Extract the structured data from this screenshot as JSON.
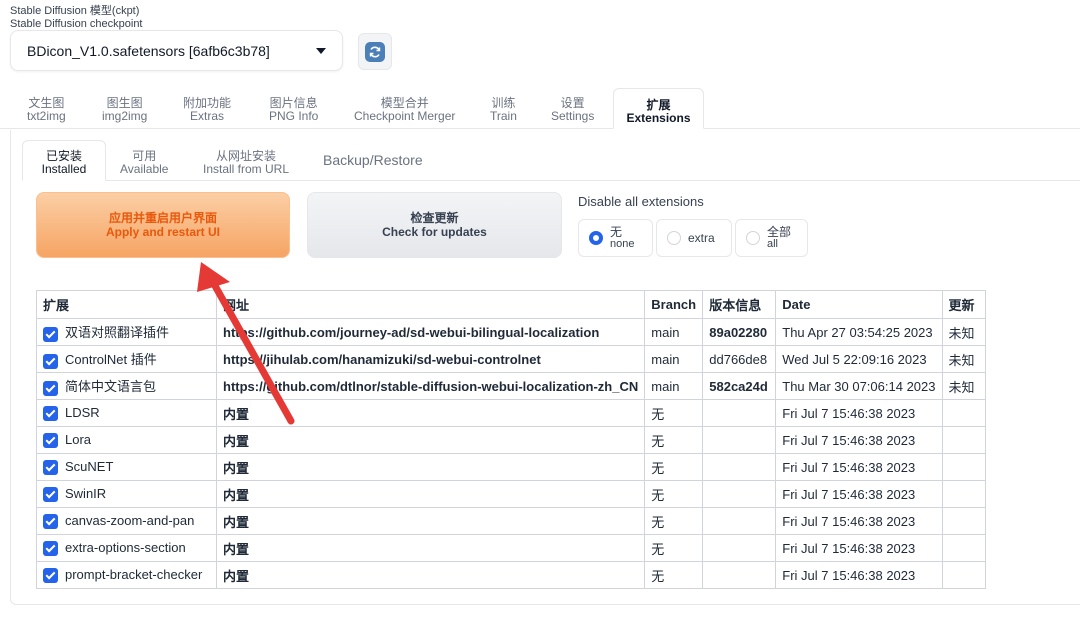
{
  "checkpoint": {
    "label_line1": "Stable Diffusion 模型(ckpt)",
    "label_line2": "Stable Diffusion checkpoint",
    "value": "BDicon_V1.0.safetensors [6afb6c3b78]"
  },
  "main_tabs": [
    {
      "cn": "文生图",
      "en": "txt2img"
    },
    {
      "cn": "图生图",
      "en": "img2img"
    },
    {
      "cn": "附加功能",
      "en": "Extras"
    },
    {
      "cn": "图片信息",
      "en": "PNG Info"
    },
    {
      "cn": "模型合并",
      "en": "Checkpoint Merger"
    },
    {
      "cn": "训练",
      "en": "Train"
    },
    {
      "cn": "设置",
      "en": "Settings"
    },
    {
      "cn": "扩展",
      "en": "Extensions"
    }
  ],
  "sub_tabs": [
    {
      "cn": "已安装",
      "en": "Installed"
    },
    {
      "cn": "可用",
      "en": "Available"
    },
    {
      "cn": "从网址安装",
      "en": "Install from URL"
    },
    {
      "label": "Backup/Restore"
    }
  ],
  "apply_button": {
    "cn": "应用并重启用户界面",
    "en": "Apply and restart UI"
  },
  "check_button": {
    "cn": "检查更新",
    "en": "Check for updates"
  },
  "disable": {
    "label": "Disable all extensions",
    "options": [
      {
        "cn": "无",
        "en": "none",
        "selected": true
      },
      {
        "label": "extra",
        "selected": false
      },
      {
        "cn": "全部",
        "en": "all",
        "selected": false
      }
    ]
  },
  "table": {
    "headers": [
      "扩展",
      "网址",
      "Branch",
      "版本信息",
      "Date",
      "更新"
    ],
    "rows": [
      {
        "name": "双语对照翻译插件",
        "url": "https://github.com/journey-ad/sd-webui-bilingual-localization",
        "branch": "main",
        "version": "89a02280",
        "date": "Thu Apr 27 03:54:25 2023",
        "update": "未知"
      },
      {
        "name": "ControlNet 插件",
        "url": "https://jihulab.com/hanamizuki/sd-webui-controlnet",
        "branch": "main",
        "version": "dd766de8",
        "date": "Wed Jul 5 22:09:16 2023",
        "update": "未知"
      },
      {
        "name": "简体中文语言包",
        "url": "https://github.com/dtlnor/stable-diffusion-webui-localization-zh_CN",
        "branch": "main",
        "version": "582ca24d",
        "date": "Thu Mar 30 07:06:14 2023",
        "update": "未知"
      },
      {
        "name": "LDSR",
        "url": "内置",
        "branch": "无",
        "version": "",
        "date": "Fri Jul 7 15:46:38 2023",
        "update": ""
      },
      {
        "name": "Lora",
        "url": "内置",
        "branch": "无",
        "version": "",
        "date": "Fri Jul 7 15:46:38 2023",
        "update": ""
      },
      {
        "name": "ScuNET",
        "url": "内置",
        "branch": "无",
        "version": "",
        "date": "Fri Jul 7 15:46:38 2023",
        "update": ""
      },
      {
        "name": "SwinIR",
        "url": "内置",
        "branch": "无",
        "version": "",
        "date": "Fri Jul 7 15:46:38 2023",
        "update": ""
      },
      {
        "name": "canvas-zoom-and-pan",
        "url": "内置",
        "branch": "无",
        "version": "",
        "date": "Fri Jul 7 15:46:38 2023",
        "update": ""
      },
      {
        "name": "extra-options-section",
        "url": "内置",
        "branch": "无",
        "version": "",
        "date": "Fri Jul 7 15:46:38 2023",
        "update": ""
      },
      {
        "name": "prompt-bracket-checker",
        "url": "内置",
        "branch": "无",
        "version": "",
        "date": "Fri Jul 7 15:46:38 2023",
        "update": ""
      }
    ]
  },
  "colors": {
    "accent": "#2563eb",
    "apply_text": "#ea580c",
    "annotation_arrow": "#e53935"
  }
}
